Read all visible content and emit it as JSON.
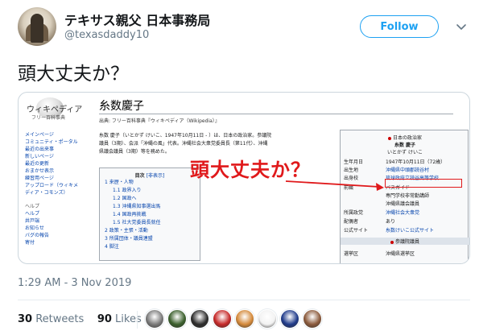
{
  "tweet": {
    "display_name": "テキサス親父 日本事務局",
    "handle": "@texasdaddy10",
    "follow_label": "Follow",
    "text": "頭大丈夫か？",
    "timestamp": "1:29 AM - 3 Nov 2019",
    "retweets_count": "30",
    "retweets_label": "Retweets",
    "likes_count": "90",
    "likes_label": "Likes",
    "liker_colors": [
      "#7a7a7a",
      "#3a5f2c",
      "#2b2b2b",
      "#c62828",
      "#d4893a",
      "#f2f2f2",
      "#1e3a8a",
      "#8b5a3c"
    ]
  },
  "screenshot": {
    "logo_name": "ウィキペディア",
    "logo_sub": "フリー百科事典",
    "sidebar": [
      "メインページ",
      "コミュニティ・ポータル",
      "最近の出来事",
      "新しいページ",
      "最近の更新",
      "おまかせ表示",
      "練習用ページ",
      "アップロード（ウィキメディア・コモンズ）"
    ],
    "sidebar_help_head": "ヘルプ",
    "sidebar_help": [
      "ヘルプ",
      "井戸端",
      "お知らせ",
      "バグの報告",
      "寄付"
    ],
    "title": "糸数慶子",
    "from": "出典: フリー百科事典『ウィキペディア（Wikipedia）』",
    "lead_1": "糸数 慶子（いとかず けいこ、1947年10月11日 - ）は、日本の政治家。参議院",
    "lead_2": "議員（3期）、会派「沖縄の風」代表。沖縄社会大衆党委員長（第11代）、沖縄",
    "lead_3": "県議会議員（3期）等を務めた。",
    "toc_title": "目次",
    "toc_hide": "[非表示]",
    "toc": [
      {
        "label": "1 来歴・人物",
        "sub": false
      },
      {
        "label": "1.1 政界入り",
        "sub": true
      },
      {
        "label": "1.2 国政へ",
        "sub": true
      },
      {
        "label": "1.3 沖縄県知事選出馬",
        "sub": true
      },
      {
        "label": "1.4 国政再挑戦",
        "sub": true
      },
      {
        "label": "1.5 社大党委員長就任",
        "sub": true
      },
      {
        "label": "2 政策・主張・活動",
        "sub": false
      },
      {
        "label": "3 所属団体・議員連盟",
        "sub": false
      },
      {
        "label": "4 脚注",
        "sub": false
      }
    ],
    "infobox": {
      "header": "日本の政治家",
      "name": "糸数 慶子",
      "kana": "いとかず けいこ",
      "rows": [
        {
          "k": "生年月日",
          "v": "1947年10月11日（72歳）"
        },
        {
          "k": "出生地",
          "v": "沖縄県中頭郡読谷村"
        },
        {
          "k": "出身校",
          "v": "琉球政府立読谷高等学校"
        },
        {
          "k": "前職",
          "v": "バスガイド"
        },
        {
          "k": "",
          "v": "専門学校非常勤講師"
        },
        {
          "k": "",
          "v": "沖縄県議会議員"
        },
        {
          "k": "所属政党",
          "v": "沖縄社会大衆党"
        },
        {
          "k": "配偶者",
          "v": "あり"
        },
        {
          "k": "公式サイト",
          "v": "糸数けいこ公式サイト"
        }
      ],
      "band": "参議院議員",
      "district_k": "選挙区",
      "district_v": "沖縄県選挙区"
    },
    "overlay_text": "頭大丈夫か？",
    "overlay_color": "#e0191b"
  }
}
